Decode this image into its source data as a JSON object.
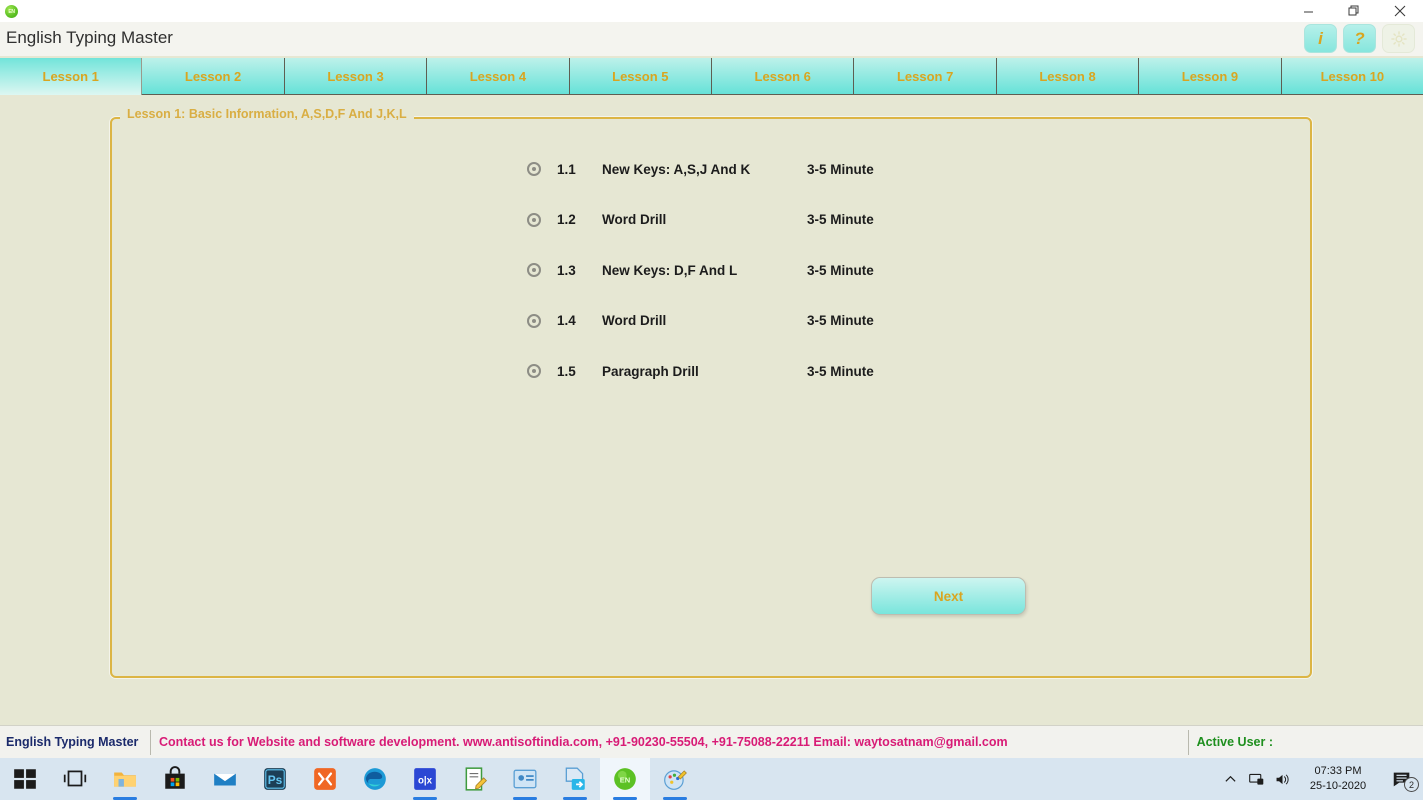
{
  "window": {
    "icon_name": "en-language-icon",
    "icon_label": "EN",
    "minimize_label": "minimize-icon",
    "maximize_label": "restore-icon",
    "close_label": "close-icon"
  },
  "header": {
    "title": "English Typing Master",
    "buttons": [
      {
        "name": "info-button",
        "label": "i"
      },
      {
        "name": "help-button",
        "label": "?"
      },
      {
        "name": "settings-button",
        "label": ""
      }
    ]
  },
  "tabs": [
    {
      "label": "Lesson 1",
      "active": true
    },
    {
      "label": "Lesson 2",
      "active": false
    },
    {
      "label": "Lesson 3",
      "active": false
    },
    {
      "label": "Lesson 4",
      "active": false
    },
    {
      "label": "Lesson 5",
      "active": false
    },
    {
      "label": "Lesson 6",
      "active": false
    },
    {
      "label": "Lesson 7",
      "active": false
    },
    {
      "label": "Lesson 8",
      "active": false
    },
    {
      "label": "Lesson 9",
      "active": false
    },
    {
      "label": "Lesson 10",
      "active": false
    }
  ],
  "groupbox": {
    "legend": "Lesson 1: Basic Information, A,S,D,F And J,K,L"
  },
  "lessons": [
    {
      "number": "1.1",
      "name": "New Keys: A,S,J And K",
      "duration": "3-5 Minute"
    },
    {
      "number": "1.2",
      "name": "Word Drill",
      "duration": "3-5 Minute"
    },
    {
      "number": "1.3",
      "name": "New Keys: D,F And L",
      "duration": "3-5 Minute"
    },
    {
      "number": "1.4",
      "name": "Word Drill",
      "duration": "3-5 Minute"
    },
    {
      "number": "1.5",
      "name": "Paragraph Drill",
      "duration": "3-5 Minute"
    }
  ],
  "actions": {
    "next_label": "Next"
  },
  "statusbar": {
    "brand": "English Typing Master",
    "contact": "Contact us for Website and software development. www.antisoftindia.com, +91-90230-55504, +91-75088-22211  Email: waytosatnam@gmail.com",
    "active_user": "Active User :"
  },
  "taskbar": {
    "items": [
      {
        "name": "start-button",
        "icon": "windows-icon",
        "active": false,
        "running": false
      },
      {
        "name": "task-view-button",
        "icon": "task-view-icon",
        "active": false,
        "running": false
      },
      {
        "name": "file-explorer-button",
        "icon": "folder-icon",
        "active": false,
        "running": true
      },
      {
        "name": "microsoft-store-button",
        "icon": "store-bag-icon",
        "active": false,
        "running": false
      },
      {
        "name": "mail-button",
        "icon": "mail-envelope-icon",
        "active": false,
        "running": false
      },
      {
        "name": "photoshop-button",
        "icon": "photoshop-ps-icon",
        "active": false,
        "running": false
      },
      {
        "name": "xampp-button",
        "icon": "orange-app-icon",
        "active": false,
        "running": true
      },
      {
        "name": "edge-button",
        "icon": "edge-browser-icon",
        "active": false,
        "running": false
      },
      {
        "name": "olx-button",
        "icon": "olx-icon",
        "active": false,
        "running": true
      },
      {
        "name": "notepad-editor-button",
        "icon": "notepad-pencil-icon",
        "active": false,
        "running": false
      },
      {
        "name": "contacts-button",
        "icon": "contact-card-icon",
        "active": false,
        "running": true
      },
      {
        "name": "export-button",
        "icon": "file-export-icon",
        "active": false,
        "running": true
      },
      {
        "name": "english-typing-master-button",
        "icon": "en-green-icon",
        "active": true,
        "running": true
      },
      {
        "name": "paint-button",
        "icon": "paint-palette-icon",
        "active": false,
        "running": true
      }
    ],
    "tray": {
      "show_hidden_label": "chevron-up-icon",
      "network_label": "network-icon",
      "volume_label": "volume-icon",
      "time": "07:33 PM",
      "date": "25-10-2020",
      "notification_count": "2"
    }
  },
  "colors": {
    "page_bg": "#e6e7d3",
    "tab_accent": "#66e2d8",
    "gold_text": "#d9a520",
    "group_border": "#dcb544",
    "status_contact": "#d81b76",
    "status_brand": "#1b2a6b",
    "status_user": "#1e8f1e"
  }
}
